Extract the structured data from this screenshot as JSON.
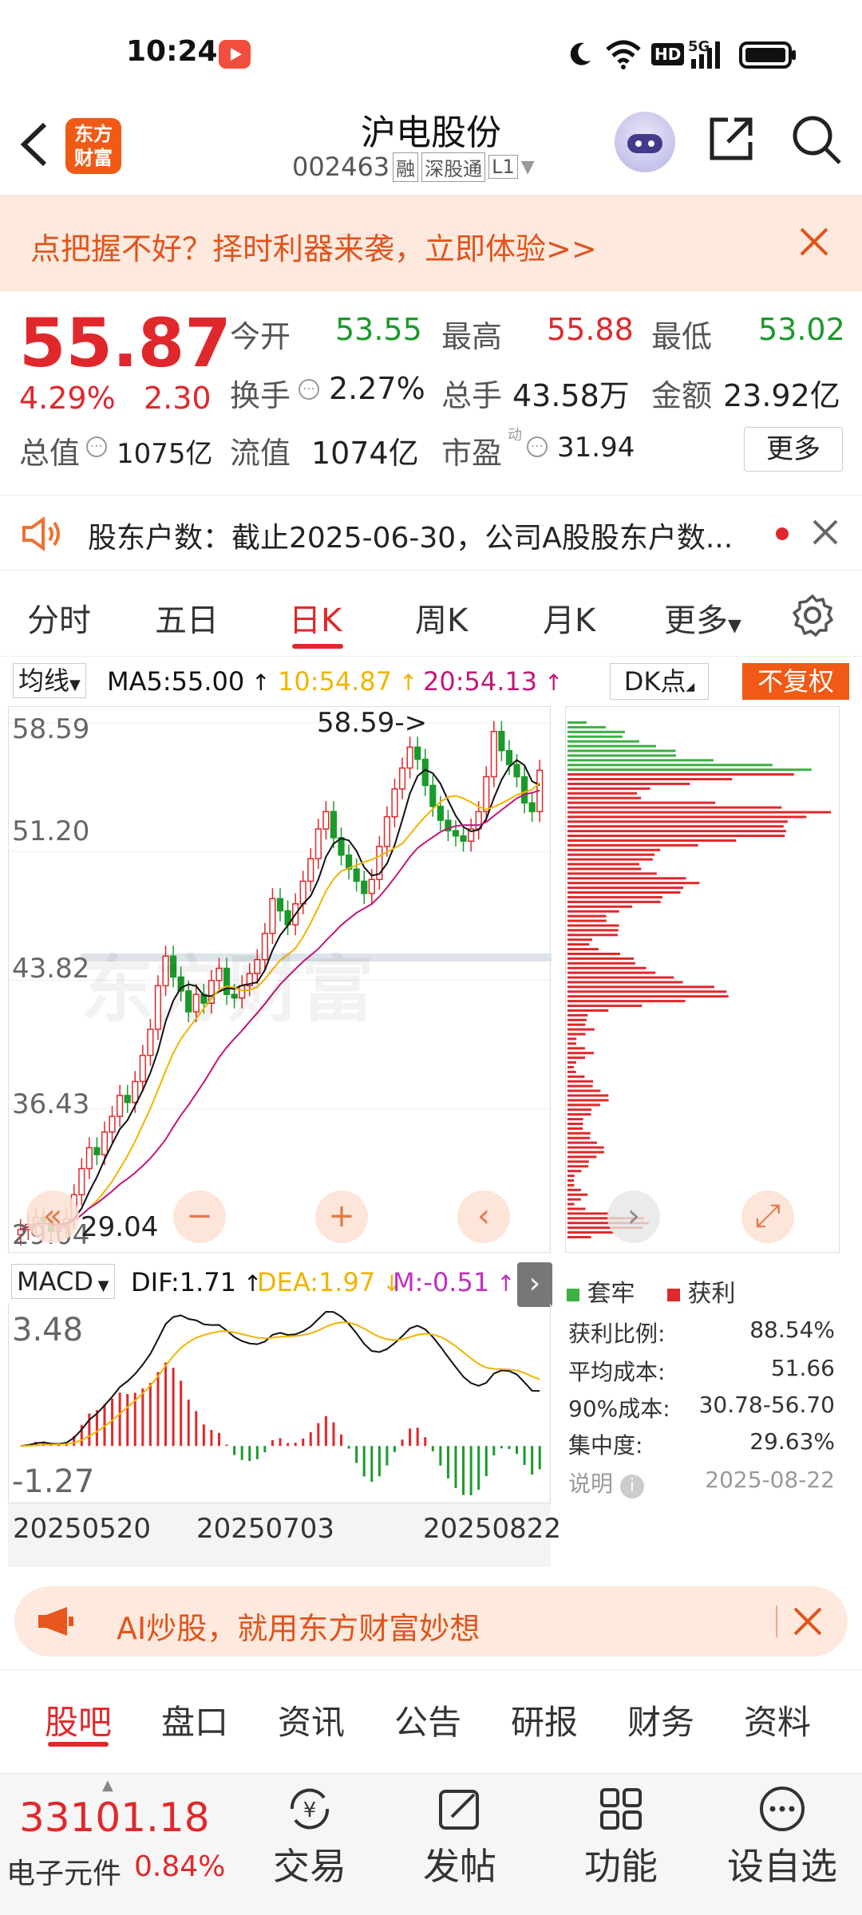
{
  "status": {
    "time": "10:24",
    "hd": "HD",
    "net": "5G"
  },
  "nav": {
    "title": "沪电股份",
    "code": "002463",
    "badges": [
      "融",
      "深股通",
      "L1"
    ],
    "logo_line1": "东方",
    "logo_line2": "财富"
  },
  "banner": {
    "text": "点把握不好？择时利器来袭，立即体验>>"
  },
  "quote": {
    "price": "55.87",
    "pct": "4.29%",
    "change": "2.30",
    "open_label": "今开",
    "open": "53.55",
    "high_label": "最高",
    "high": "55.88",
    "low_label": "最低",
    "low": "53.02",
    "turnover_label": "换手",
    "turnover": "2.27%",
    "volume_label": "总手",
    "volume": "43.58万",
    "amount_label": "金额",
    "amount": "23.92亿",
    "mcap_label": "总值",
    "mcap": "1075亿",
    "float_label": "流值",
    "float": "1074亿",
    "pe_label": "市盈",
    "pe_sup": "动",
    "pe": "31.94",
    "more": "更多"
  },
  "notice": {
    "text": "股东户数：截止2025-06-30，公司A股股东户数..."
  },
  "tabs": [
    "分时",
    "五日",
    "日K",
    "周K",
    "月K",
    "更多"
  ],
  "active_tab": "日K",
  "chart_head": {
    "ma_toggle": "均线",
    "ma5": "MA5:55.00",
    "ma10": "10:54.87",
    "ma20": "20:54.13",
    "dk": "DK点",
    "fq": "不复权"
  },
  "chart_data": {
    "type": "candlestick",
    "y_ticks": [
      "58.59",
      "51.20",
      "43.82",
      "36.43",
      "29.04"
    ],
    "ylim": [
      29.04,
      58.59
    ],
    "annot_high": "58.59->",
    "annot_low": "29.04",
    "x_ticks": [
      "20250520",
      "20250703",
      "20250822"
    ],
    "closes": [
      29.5,
      29.8,
      30.2,
      30.0,
      29.4,
      29.6,
      30.1,
      31.5,
      33.0,
      34.2,
      33.8,
      35.1,
      36.0,
      37.2,
      36.8,
      38.0,
      39.5,
      41.0,
      43.5,
      45.2,
      44.0,
      43.2,
      42.0,
      43.0,
      42.5,
      43.8,
      44.5,
      43.0,
      42.8,
      43.5,
      44.2,
      45.0,
      46.5,
      48.5,
      47.8,
      47.0,
      48.2,
      49.5,
      50.8,
      52.5,
      53.5,
      52.0,
      51.0,
      50.2,
      49.5,
      48.8,
      49.6,
      51.5,
      53.2,
      54.8,
      56.0,
      57.2,
      56.5,
      55.0,
      53.8,
      53.0,
      52.4,
      52.1,
      51.8,
      52.5,
      53.5,
      55.5,
      58.1,
      57.0,
      56.2,
      55.5,
      54.0,
      53.5,
      55.87
    ]
  },
  "macd_head": {
    "label": "MACD",
    "dif": "DIF:1.71",
    "dea": "DEA:1.97",
    "m": "M:-0.51"
  },
  "macd_data": {
    "y_ticks": [
      "3.48",
      "-1.27"
    ]
  },
  "chip": {
    "legend_trapped": "套牢",
    "legend_profit": "获利",
    "rows": [
      {
        "label": "获利比例:",
        "value": "88.54%"
      },
      {
        "label": "平均成本:",
        "value": "51.66"
      },
      {
        "label": "90%成本:",
        "value": "30.78-56.70"
      },
      {
        "label": "集中度:",
        "value": "29.63%"
      }
    ],
    "explain": "说明",
    "date": "2025-08-22"
  },
  "ai": {
    "text": "AI炒股，就用东方财富妙想"
  },
  "subtabs": [
    "股吧",
    "盘口",
    "资讯",
    "公告",
    "研报",
    "财务",
    "资料"
  ],
  "active_subtab": "股吧",
  "bottom": {
    "index": "33101.18",
    "sector": "电子元件",
    "sector_pct": "0.84%",
    "trade": "交易",
    "post": "发帖",
    "func": "功能",
    "watch": "设自选"
  },
  "colors": {
    "up": "#e0282c",
    "down": "#1a9a2a",
    "ma5": "#111111",
    "ma10": "#f0b400",
    "ma20": "#c2187a",
    "accent": "#f05a14"
  }
}
